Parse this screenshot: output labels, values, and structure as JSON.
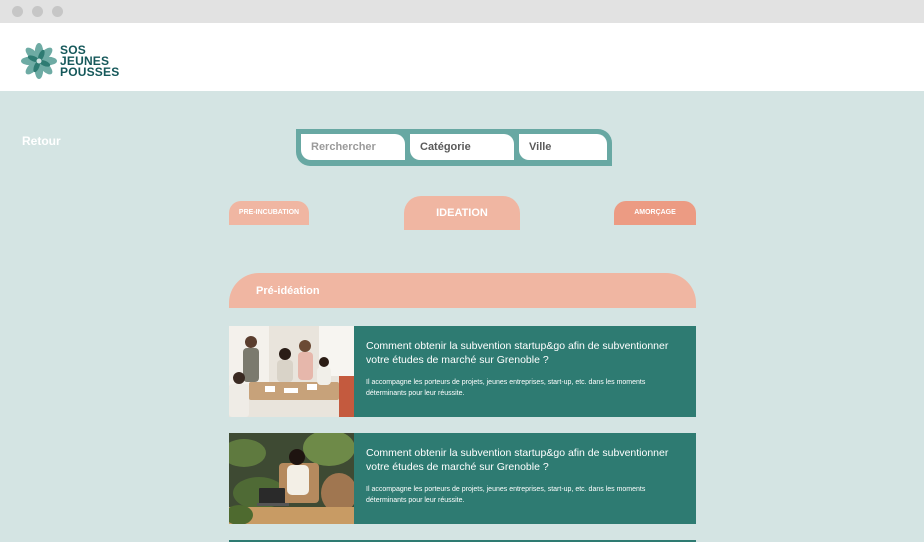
{
  "header": {
    "logo": {
      "icon": "lotus-flower-logo",
      "line1": "SOS",
      "line2": "JEUNES",
      "line3": "POUSSES"
    }
  },
  "nav": {
    "back_label": "Retour"
  },
  "search": {
    "query_placeholder": "Rerchercher",
    "category_label": "Catégorie",
    "city_label": "Ville"
  },
  "stages": [
    {
      "label": "PRE-INCUBATION"
    },
    {
      "label": "IDEATION"
    },
    {
      "label": "AMORÇAGE"
    }
  ],
  "section": {
    "title": "Pré-idéation"
  },
  "cards": [
    {
      "title": "Comment obtenir la subvention startup&go afin de subventionner votre études de marché sur Grenoble ?",
      "description": "Il accompagne les porteurs de projets, jeunes entreprises, start-up, etc. dans les moments déterminants pour leur réussite."
    },
    {
      "title": "Comment obtenir la subvention startup&go afin de subventionner votre études de marché sur Grenoble ?",
      "description": "Il accompagne les porteurs de projets, jeunes entreprises, start-up, etc. dans les moments déterminants pour leur réussite."
    }
  ],
  "colors": {
    "background": "#d4e4e3",
    "primary": "#2e7b72",
    "accent": "#f0b6a2",
    "accent_strong": "#ec9b83",
    "search_frame": "#68a8a3",
    "logo_text": "#15585a"
  }
}
